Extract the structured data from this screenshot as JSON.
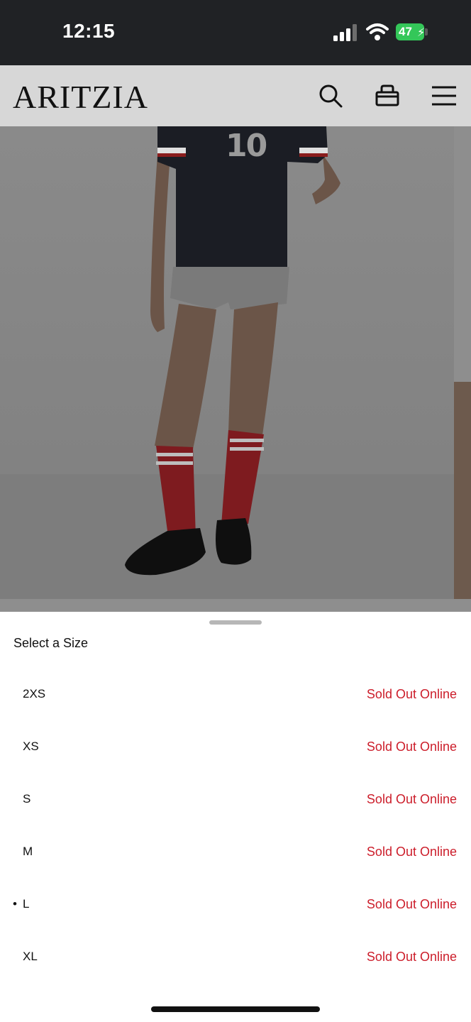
{
  "status_bar": {
    "time": "12:15",
    "battery": "47"
  },
  "header": {
    "logo": "ARITZIA",
    "icons": [
      "search-icon",
      "bag-icon",
      "menu-icon"
    ]
  },
  "product": {
    "jersey_number": "10"
  },
  "size_sheet": {
    "title": "Select a Size",
    "sizes": [
      {
        "label": "2XS",
        "status": "Sold Out Online",
        "selected": false
      },
      {
        "label": "XS",
        "status": "Sold Out Online",
        "selected": false
      },
      {
        "label": "S",
        "status": "Sold Out Online",
        "selected": false
      },
      {
        "label": "M",
        "status": "Sold Out Online",
        "selected": false
      },
      {
        "label": "L",
        "status": "Sold Out Online",
        "selected": true,
        "marker": "•"
      },
      {
        "label": "XL",
        "status": "Sold Out Online",
        "selected": false
      }
    ]
  },
  "colors": {
    "sold_out_red": "#cc1d2a",
    "battery_green": "#34c759",
    "status_bar_bg": "#202225"
  }
}
